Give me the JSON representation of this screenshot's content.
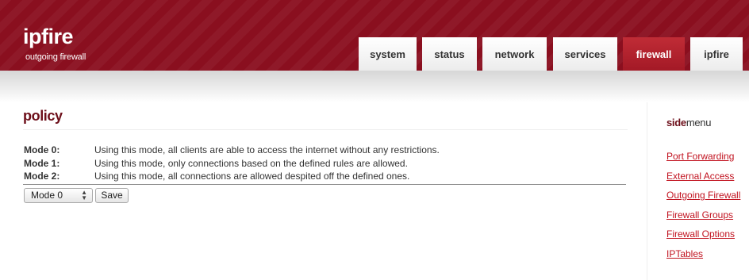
{
  "header": {
    "logo_title": "ipfire",
    "logo_subtitle": "outgoing firewall",
    "tabs": [
      {
        "label": "system",
        "active": false
      },
      {
        "label": "status",
        "active": false
      },
      {
        "label": "network",
        "active": false
      },
      {
        "label": "services",
        "active": false
      },
      {
        "label": "firewall",
        "active": true
      },
      {
        "label": "ipfire",
        "active": false
      }
    ]
  },
  "main": {
    "title": "policy",
    "modes": [
      {
        "label": "Mode 0:",
        "description": "Using this mode, all clients are able to access the internet without any restrictions."
      },
      {
        "label": "Mode 1:",
        "description": "Using this mode, only connections based on the defined rules are allowed."
      },
      {
        "label": "Mode 2:",
        "description": "Using this mode, all connections are allowed despited off the defined ones."
      }
    ],
    "mode_select": {
      "selected": "Mode 0"
    },
    "save_label": "Save"
  },
  "sidebar": {
    "title_bold": "side",
    "title_rest": "menu",
    "links": [
      {
        "label": "Port Forwarding"
      },
      {
        "label": "External Access"
      },
      {
        "label": "Outgoing Firewall"
      },
      {
        "label": "Firewall Groups"
      },
      {
        "label": "Firewall Options"
      },
      {
        "label": "IPTables"
      }
    ]
  },
  "colors": {
    "header_red": "#8a0f1f",
    "active_tab": "#b1202c",
    "title_maroon": "#6d0f1a",
    "link_red": "#c1121f"
  }
}
